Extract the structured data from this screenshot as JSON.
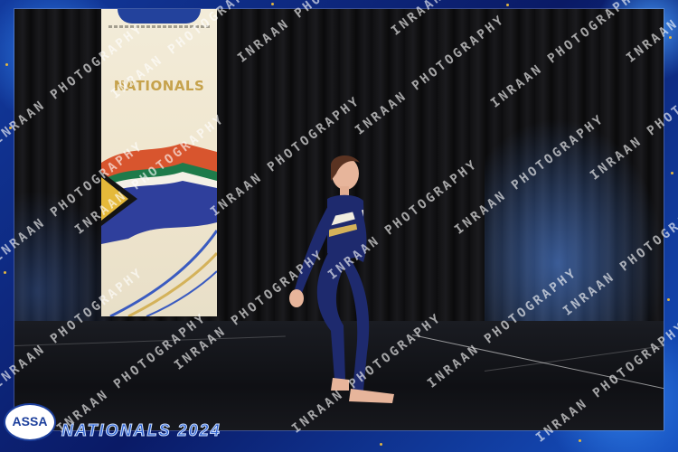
{
  "banner": {
    "title": "NATIONALS"
  },
  "watermark": {
    "text": "INRAAN PHOTOGRAPHY"
  },
  "footer": {
    "logo_text": "ASSA",
    "event_label": "NATIONALS 2024"
  },
  "colors": {
    "frame_blue": "#0b1c6e",
    "accent_gold": "#c6a24c",
    "label_blue": "#2a5fd0",
    "costume_navy": "#1e2a6e"
  }
}
